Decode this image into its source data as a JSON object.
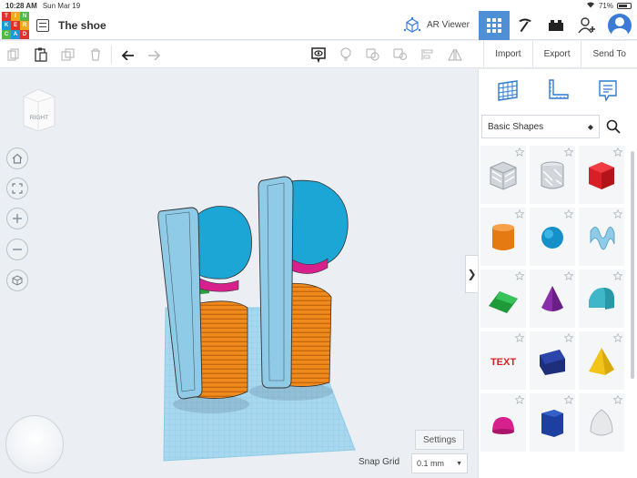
{
  "status": {
    "time": "10:28 AM",
    "date": "Sun Mar 19",
    "battery": "71%",
    "battery_level": 0.71
  },
  "header": {
    "logo_letters": [
      "T",
      "I",
      "N",
      "K",
      "E",
      "R",
      "C",
      "A",
      "D"
    ],
    "title": "The shoe",
    "ar_label": "AR Viewer"
  },
  "toolbar": {
    "import_label": "Import",
    "export_label": "Export",
    "sendto_label": "Send To"
  },
  "viewport": {
    "viewcube_label": "RIGHT",
    "settings_label": "Settings",
    "snap_label": "Snap Grid",
    "snap_value": "0.1 mm",
    "collapse_glyph": "❯"
  },
  "panel": {
    "library": "Basic Shapes"
  },
  "colors": {
    "accent": "#4f8fd6",
    "workplane": "#a8d8ef",
    "light_blue_shape": "#8fcbe6",
    "blue_shape": "#1ba6d6",
    "orange_shape": "#f08a1c",
    "magenta_shape": "#d8208c",
    "logo": [
      "#e2312d",
      "#f4a81d",
      "#53b848",
      "#1a9ad6",
      "#e2312d",
      "#f4a81d",
      "#53b848",
      "#1a9ad6",
      "#e2312d"
    ]
  },
  "shapes": [
    {
      "name": "box-hole",
      "icon": "box-hole-icon"
    },
    {
      "name": "cylinder-hole",
      "icon": "cylinder-hole-icon"
    },
    {
      "name": "box",
      "icon": "box-icon"
    },
    {
      "name": "cylinder",
      "icon": "cylinder-icon"
    },
    {
      "name": "sphere",
      "icon": "sphere-icon"
    },
    {
      "name": "scribble",
      "icon": "scribble-icon"
    },
    {
      "name": "roof",
      "icon": "roof-icon"
    },
    {
      "name": "cone",
      "icon": "cone-icon"
    },
    {
      "name": "round-roof",
      "icon": "round-roof-icon"
    },
    {
      "name": "text",
      "icon": "text-icon"
    },
    {
      "name": "wedge",
      "icon": "wedge-icon"
    },
    {
      "name": "pyramid",
      "icon": "pyramid-icon"
    },
    {
      "name": "half-sphere",
      "icon": "half-sphere-icon"
    },
    {
      "name": "polygon",
      "icon": "polygon-icon"
    },
    {
      "name": "paraboloid",
      "icon": "paraboloid-icon"
    }
  ]
}
